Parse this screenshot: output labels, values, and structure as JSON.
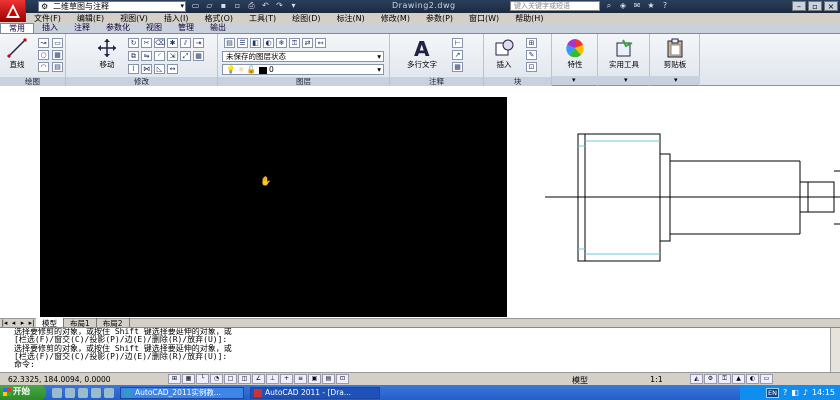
{
  "titlebar": {
    "workspace": "二维草图与注释",
    "doc_title": "Drawing2.dwg",
    "search_placeholder": "键入关键字或短语"
  },
  "menu": [
    "文件(F)",
    "编辑(E)",
    "视图(V)",
    "插入(I)",
    "格式(O)",
    "工具(T)",
    "绘图(D)",
    "标注(N)",
    "修改(M)",
    "参数(P)",
    "窗口(W)",
    "帮助(H)"
  ],
  "ribbon_tabs": [
    "常用",
    "插入",
    "注释",
    "参数化",
    "视图",
    "管理",
    "输出"
  ],
  "ribbon": {
    "draw": {
      "label": "绘图",
      "line_label": "直线"
    },
    "modify": {
      "label": "修改",
      "move_label": "移动"
    },
    "layers": {
      "label": "图层",
      "state_combo": "未保存的图层状态",
      "current_layer": "0"
    },
    "annotation": {
      "label": "注释",
      "mtext_label": "多行文字"
    },
    "block": {
      "label": "块",
      "insert_label": "插入"
    },
    "properties": {
      "label": "特性"
    },
    "utilities": {
      "label": "实用工具"
    },
    "clipboard": {
      "label": "剪贴板"
    }
  },
  "layout_tabs": [
    "模型",
    "布局1",
    "布局2"
  ],
  "command_lines": [
    "选择要修剪的对象，或按住 Shift 键选择要延伸的对象，或",
    "[栏选(F)/窗交(C)/投影(P)/边(E)/删除(R)/放弃(U)]:",
    "选择要修剪的对象，或按住 Shift 键选择要延伸的对象，或",
    "[栏选(F)/窗交(C)/投影(P)/边(E)/删除(R)/放弃(U)]:",
    "命令:"
  ],
  "status": {
    "coords": "62.3325, 184.0094, 0.0000",
    "model": "模型",
    "scale": "1:1"
  },
  "taskbar": {
    "start": "开始",
    "tasks": [
      "AutoCAD_2011实例教...",
      "AutoCAD 2011 - [Dra..."
    ],
    "lang": "EN",
    "clock": "14:15"
  },
  "colors": {
    "viewport_bg": "#000000",
    "title_bg": "#1b2a40",
    "taskbar": "#245ec9"
  }
}
